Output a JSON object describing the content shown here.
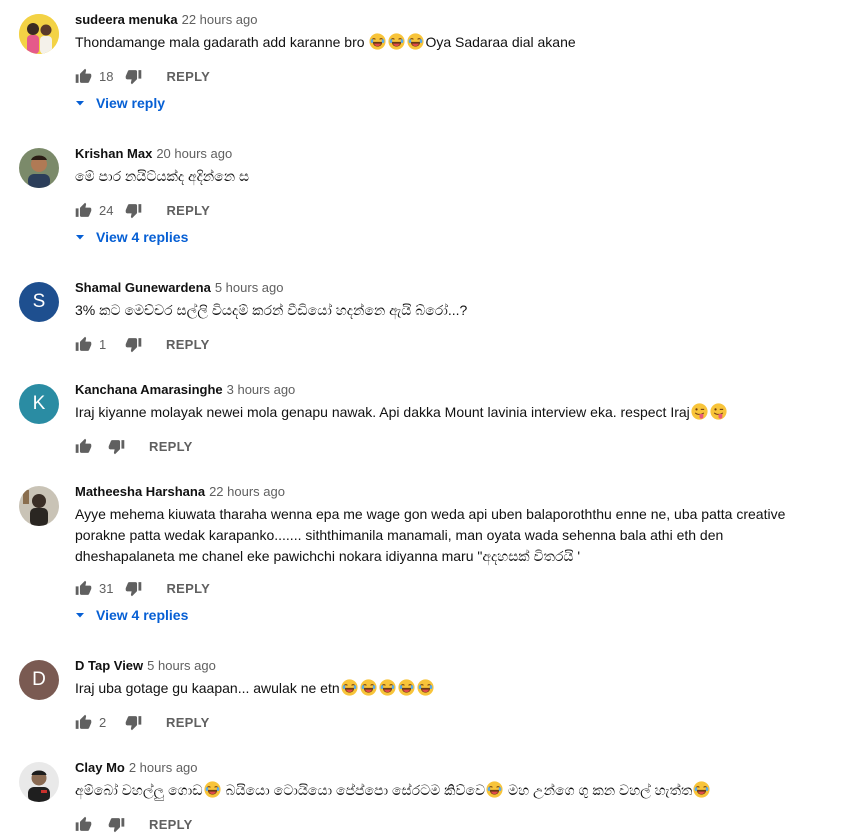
{
  "reply_label": "REPLY",
  "colors": {
    "link": "#065fd4",
    "avatar_s": "#1e4f8f",
    "avatar_k": "#2a8ca3",
    "avatar_d": "#7a5a52"
  },
  "comments": [
    {
      "author": "sudeera menuka",
      "time": "22 hours ago",
      "text": "Thondamange mala gadarath add karanne bro ",
      "text_after_emoji": "Oya Sadaraa dial akane",
      "likes": "18",
      "view_replies": "View reply",
      "avatar": "photo-avatar"
    },
    {
      "author": "Krishan Max",
      "time": "20 hours ago",
      "text": "මේ පාර නයිට්යක්ද අදින්නෙ ස",
      "likes": "24",
      "view_replies": "View 4 replies",
      "avatar": "photo-avatar"
    },
    {
      "author": "Shamal Gunewardena",
      "time": "5 hours ago",
      "text": "3% කට මෙච්චර සල්ලි වියදම් කරන් වීඩියෝ හදන්නෙ ඇයි බ්රෝ...?",
      "likes": "1",
      "avatar_letter": "S"
    },
    {
      "author": "Kanchana Amarasinghe",
      "time": "3 hours ago",
      "text": "Iraj kiyanne molayak newei mola genapu nawak. Api dakka Mount lavinia interview eka. respect Iraj",
      "likes": "",
      "avatar_letter": "K"
    },
    {
      "author": "Matheesha Harshana",
      "time": "22 hours ago",
      "text": "Ayye mehema kiuwata tharaha wenna epa me wage gon weda api uben balaporoththu enne ne, uba patta creative porakne patta wedak karapanko....... siththimanila manamali, man oyata wada sehenna bala athi eth den dheshapalaneta me chanel eke pawichchi nokara idiyanna maru \"අදහසක් විතරයි '",
      "likes": "31",
      "view_replies": "View 4 replies",
      "avatar": "photo-avatar"
    },
    {
      "author": "D Tap View",
      "time": "5 hours ago",
      "text": "Iraj uba gotage gu kaapan... awulak ne etn",
      "likes": "2",
      "avatar_letter": "D"
    },
    {
      "author": "Clay Mo",
      "time": "2 hours ago",
      "text_parts": [
        "අම්බෝ වහල්ලු ගොඩ",
        " බයියො ටොයියො පේප්පො සේරටම කිව්වෙ",
        " මහ උන්ගෙ ගු කන වහල් හැත්ත"
      ],
      "likes": "",
      "avatar": "photo-avatar"
    }
  ]
}
